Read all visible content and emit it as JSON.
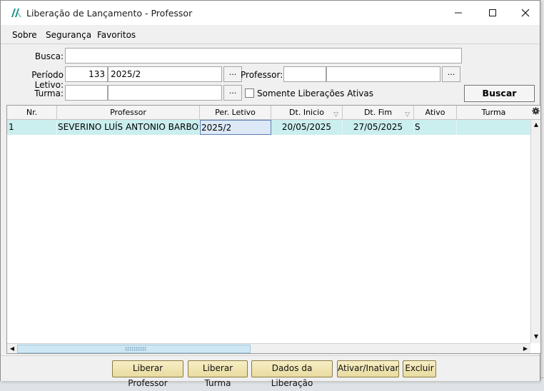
{
  "window": {
    "title": "Liberação de Lançamento - Professor"
  },
  "menu": [
    "Sobre",
    "Segurança",
    "Favoritos"
  ],
  "form": {
    "busca_label": "Busca:",
    "busca_value": "",
    "periodo_label": "Período Letivo:",
    "periodo_code": "133",
    "periodo_desc": "2025/2",
    "professor_label": "Professor:",
    "professor_code": "",
    "professor_name": "",
    "turma_label": "Turma:",
    "turma_code": "",
    "turma_name": "",
    "lookup_label": "...",
    "somente_ativas_label": "Somente Liberações Ativas",
    "somente_ativas_checked": false,
    "buscar_label": "Buscar"
  },
  "grid": {
    "columns": [
      "Nr.",
      "Professor",
      "Per. Letivo",
      "Dt. Inicio",
      "Dt. Fim",
      "Ativo",
      "Turma"
    ],
    "rows": [
      {
        "nr": "1",
        "professor": "SEVERINO LUÍS ANTONIO BARBOSA",
        "per_letivo": "2025/2",
        "dt_inicio": "20/05/2025",
        "dt_fim": "27/05/2025",
        "ativo": "S",
        "turma": ""
      }
    ]
  },
  "actions": {
    "liberar_professor": "Liberar Professor",
    "liberar_turma": "Liberar Turma",
    "dados_liberacao": "Dados da Liberação",
    "ativar_inativar": "Ativar/Inativar",
    "excluir": "Excluir"
  },
  "colors": {
    "accent_row": "#cbeeee",
    "action_button": "#efe3b0",
    "app_icon": "#1a8f86"
  }
}
